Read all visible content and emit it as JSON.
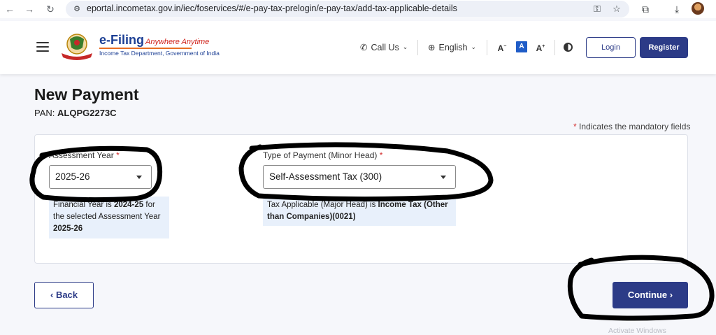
{
  "browser": {
    "url": "eportal.incometax.gov.in/iec/foservices/#/e-pay-tax-prelogin/e-pay-tax/add-tax-applicable-details",
    "icons": [
      "back-arrow-icon",
      "forward-arrow-icon",
      "reload-icon",
      "site-settings-icon",
      "key-icon",
      "star-icon",
      "extensions-icon",
      "download-icon",
      "profile-avatar"
    ]
  },
  "header": {
    "logo_title": "e-Filing",
    "logo_tagline": "Anywhere Anytime",
    "logo_subtitle": "Income Tax Department, Government of India",
    "call_us": "Call Us",
    "language": "English",
    "font_decrease": "A",
    "font_default": "A",
    "font_increase": "A",
    "login": "Login",
    "register": "Register",
    "colors": {
      "brand_navy": "#2c3b87",
      "logo_orange": "#e96d22",
      "logo_red": "#d0231b"
    }
  },
  "page": {
    "title": "New Payment",
    "pan_label": "PAN:",
    "pan_value": "ALQPG2273C",
    "mandatory_note": "Indicates the mandatory fields",
    "mandatory_star": "*"
  },
  "form": {
    "assessment_year": {
      "label": "Assessment Year",
      "required": "*",
      "value": "2025-26",
      "info_prefix": "Financial Year is",
      "info_fy": "2024-25",
      "info_mid": "for the selected Assessment Year",
      "info_ay": "2025-26"
    },
    "payment_type": {
      "label": "Type of Payment (Minor Head)",
      "required": "*",
      "value": "Self-Assessment Tax (300)",
      "info_prefix": "Tax Applicable (Major Head) is",
      "info_head": "Income Tax (Other than Companies)(0021)"
    }
  },
  "actions": {
    "back": "Back",
    "continue": "Continue"
  },
  "overlay": {
    "activate_windows": "Activate Windows"
  }
}
